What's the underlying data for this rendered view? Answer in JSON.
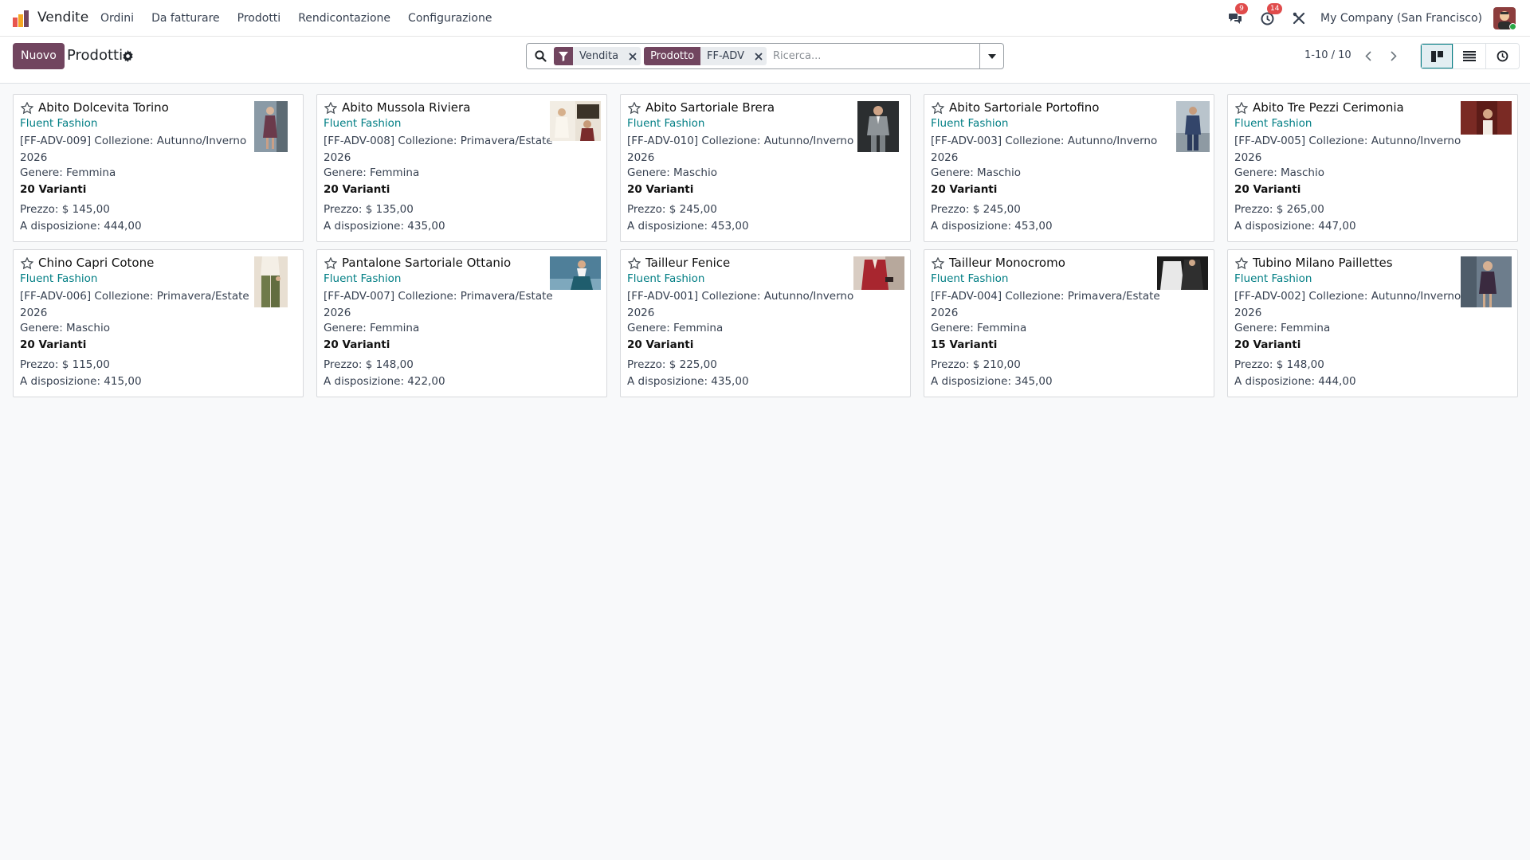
{
  "navbar": {
    "app_name": "Vendite",
    "menu": [
      "Ordini",
      "Da fatturare",
      "Prodotti",
      "Rendicontazione",
      "Configurazione"
    ],
    "messages_count": "9",
    "activities_count": "14",
    "company": "My Company (San Francisco)"
  },
  "control": {
    "new_label": "Nuovo",
    "title": "Prodotti",
    "facets": [
      {
        "value": "Vendita"
      },
      {
        "label": "Prodotto",
        "value": "FF-ADV"
      }
    ],
    "search_placeholder": "Ricerca...",
    "pager": "1-10 / 10"
  },
  "cards": [
    {
      "name": "Abito Dolcevita Torino",
      "brand": "Fluent Fashion",
      "desc": "[FF-ADV-009] Collezione: Autunno/Inverno 2026",
      "genre": "Genere: Femmina",
      "variants": "20 Varianti",
      "price": "Prezzo: $ 145,00",
      "stock": "A disposizione: 444,00"
    },
    {
      "name": "Abito Mussola Riviera",
      "brand": "Fluent Fashion",
      "desc": "[FF-ADV-008] Collezione: Primavera/Estate 2026",
      "genre": "Genere: Femmina",
      "variants": "20 Varianti",
      "price": "Prezzo: $ 135,00",
      "stock": "A disposizione: 435,00"
    },
    {
      "name": "Abito Sartoriale Brera",
      "brand": "Fluent Fashion",
      "desc": "[FF-ADV-010] Collezione: Autunno/Inverno 2026",
      "genre": "Genere: Maschio",
      "variants": "20 Varianti",
      "price": "Prezzo: $ 245,00",
      "stock": "A disposizione: 453,00"
    },
    {
      "name": "Abito Sartoriale Portofino",
      "brand": "Fluent Fashion",
      "desc": "[FF-ADV-003] Collezione: Autunno/Inverno 2026",
      "genre": "Genere: Maschio",
      "variants": "20 Varianti",
      "price": "Prezzo: $ 245,00",
      "stock": "A disposizione: 453,00"
    },
    {
      "name": "Abito Tre Pezzi Cerimonia",
      "brand": "Fluent Fashion",
      "desc": "[FF-ADV-005] Collezione: Autunno/Inverno 2026",
      "genre": "Genere: Maschio",
      "variants": "20 Varianti",
      "price": "Prezzo: $ 265,00",
      "stock": "A disposizione: 447,00"
    },
    {
      "name": "Chino Capri Cotone",
      "brand": "Fluent Fashion",
      "desc": "[FF-ADV-006] Collezione: Primavera/Estate 2026",
      "genre": "Genere: Maschio",
      "variants": "20 Varianti",
      "price": "Prezzo: $ 115,00",
      "stock": "A disposizione: 415,00"
    },
    {
      "name": "Pantalone Sartoriale Ottanio",
      "brand": "Fluent Fashion",
      "desc": "[FF-ADV-007] Collezione: Primavera/Estate 2026",
      "genre": "Genere: Femmina",
      "variants": "20 Varianti",
      "price": "Prezzo: $ 148,00",
      "stock": "A disposizione: 422,00"
    },
    {
      "name": "Tailleur Fenice",
      "brand": "Fluent Fashion",
      "desc": "[FF-ADV-001] Collezione: Autunno/Inverno 2026",
      "genre": "Genere: Femmina",
      "variants": "20 Varianti",
      "price": "Prezzo: $ 225,00",
      "stock": "A disposizione: 435,00"
    },
    {
      "name": "Tailleur Monocromo",
      "brand": "Fluent Fashion",
      "desc": "[FF-ADV-004] Collezione: Primavera/Estate 2026",
      "genre": "Genere: Femmina",
      "variants": "15 Varianti",
      "price": "Prezzo: $ 210,00",
      "stock": "A disposizione: 345,00"
    },
    {
      "name": "Tubino Milano Paillettes",
      "brand": "Fluent Fashion",
      "desc": "[FF-ADV-002] Collezione: Autunno/Inverno 2026",
      "genre": "Genere: Femmina",
      "variants": "20 Varianti",
      "price": "Prezzo: $ 148,00",
      "stock": "A disposizione: 444,00"
    }
  ],
  "colors": {
    "primary": "#71455f",
    "link": "#017e84",
    "badge": "#e04b4b"
  }
}
